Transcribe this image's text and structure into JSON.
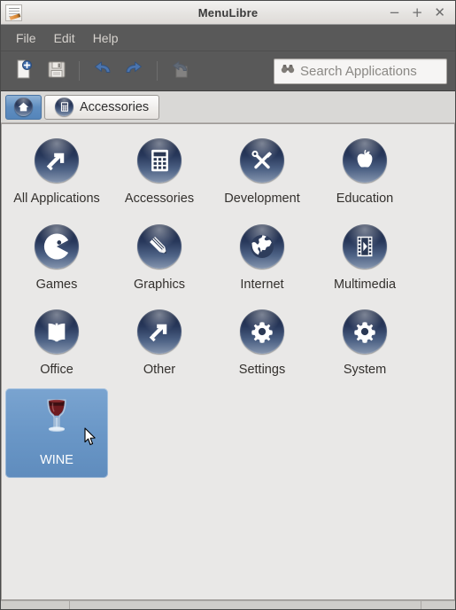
{
  "window": {
    "title": "MenuLibre",
    "app_icon": "menulibre-icon",
    "controls": {
      "minimize": "−",
      "maximize": "+",
      "close": "✕"
    }
  },
  "menubar": {
    "items": [
      {
        "label": "File",
        "name": "menu-file"
      },
      {
        "label": "Edit",
        "name": "menu-edit"
      },
      {
        "label": "Help",
        "name": "menu-help"
      }
    ]
  },
  "toolbar": {
    "buttons": [
      {
        "name": "add-new-button",
        "icon": "new-document-add-icon",
        "enabled": true
      },
      {
        "name": "save-button",
        "icon": "floppy-disk-save-icon",
        "enabled": true
      },
      {
        "name": "undo-button",
        "icon": "undo-arrow-icon",
        "enabled": true
      },
      {
        "name": "redo-button",
        "icon": "redo-arrow-icon",
        "enabled": true
      },
      {
        "name": "revert-button",
        "icon": "revert-icon",
        "enabled": false
      }
    ]
  },
  "search": {
    "placeholder": "Search Applications",
    "value": "",
    "icon": "binoculars-icon"
  },
  "breadcrumb": {
    "items": [
      {
        "label": "",
        "name": "breadcrumb-home",
        "icon": "home-icon",
        "active": true
      },
      {
        "label": "Accessories",
        "name": "breadcrumb-accessories",
        "icon": "calculator-icon",
        "active": false
      }
    ]
  },
  "grid": {
    "items": [
      {
        "label": "All Applications",
        "icon": "arrow-up-right-icon",
        "selected": false,
        "name": "category-all-applications"
      },
      {
        "label": "Accessories",
        "icon": "calculator-icon",
        "selected": false,
        "name": "category-accessories"
      },
      {
        "label": "Development",
        "icon": "tools-cross-icon",
        "selected": false,
        "name": "category-development"
      },
      {
        "label": "Education",
        "icon": "apple-icon",
        "selected": false,
        "name": "category-education"
      },
      {
        "label": "Games",
        "icon": "pacman-icon",
        "selected": false,
        "name": "category-games"
      },
      {
        "label": "Graphics",
        "icon": "pencil-icon",
        "selected": false,
        "name": "category-graphics"
      },
      {
        "label": "Internet",
        "icon": "globe-icon",
        "selected": false,
        "name": "category-internet"
      },
      {
        "label": "Multimedia",
        "icon": "film-strip-play-icon",
        "selected": false,
        "name": "category-multimedia"
      },
      {
        "label": "Office",
        "icon": "open-book-icon",
        "selected": false,
        "name": "category-office"
      },
      {
        "label": "Other",
        "icon": "arrow-up-right-icon",
        "selected": false,
        "name": "category-other"
      },
      {
        "label": "Settings",
        "icon": "gear-icon",
        "selected": false,
        "name": "category-settings"
      },
      {
        "label": "System",
        "icon": "gear-icon",
        "selected": false,
        "name": "category-system"
      },
      {
        "label": "WINE",
        "icon": "wine-glass-icon",
        "selected": true,
        "name": "category-wine"
      }
    ]
  },
  "colors": {
    "selection_blue": "#6a97c7",
    "icon_navy": "#1b2742",
    "content_bg": "#e9e8e7",
    "toolbar_bg": "#595959",
    "titlebar_bg": "#e6e4e1"
  }
}
